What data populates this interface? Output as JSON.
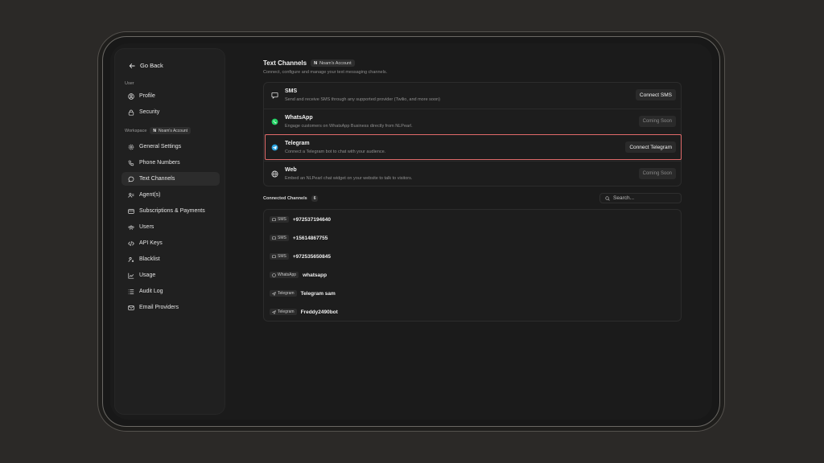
{
  "sidebar": {
    "go_back": "Go Back",
    "user_section": "User",
    "workspace_section": "Workspace",
    "workspace_badge_initial": "N",
    "workspace_badge_name": "Noam's Account",
    "items": [
      {
        "label": "Profile",
        "icon": "user-circle-icon"
      },
      {
        "label": "Security",
        "icon": "lock-icon"
      },
      {
        "label": "General Settings",
        "icon": "gear-icon"
      },
      {
        "label": "Phone Numbers",
        "icon": "phone-icon"
      },
      {
        "label": "Text Channels",
        "icon": "chat-bubble-icon",
        "active": true
      },
      {
        "label": "Agent(s)",
        "icon": "users-icon"
      },
      {
        "label": "Subscriptions & Payments",
        "icon": "credit-card-icon"
      },
      {
        "label": "Users",
        "icon": "users-group-icon"
      },
      {
        "label": "API Keys",
        "icon": "code-icon"
      },
      {
        "label": "Blacklist",
        "icon": "user-x-icon"
      },
      {
        "label": "Usage",
        "icon": "chart-icon"
      },
      {
        "label": "Audit Log",
        "icon": "list-icon"
      },
      {
        "label": "Email Providers",
        "icon": "mail-icon"
      }
    ]
  },
  "header": {
    "title": "Text Channels",
    "badge_initial": "N",
    "badge_name": "Noam's Account",
    "subtitle": "Connect, configure and manage your text messaging channels."
  },
  "channels": [
    {
      "name": "SMS",
      "desc": "Send and receive SMS through any supported provider (Twilio, and more soon)",
      "button": "Connect SMS",
      "soon": false,
      "icon": "message-square-icon"
    },
    {
      "name": "WhatsApp",
      "desc": "Engage customers on WhatsApp Business directly from NLPearl.",
      "button": "Coming Soon",
      "soon": true,
      "icon": "whatsapp-icon"
    },
    {
      "name": "Telegram",
      "desc": "Connect a Telegram bot to chat with your audience.",
      "button": "Connect Telegram",
      "soon": false,
      "icon": "telegram-icon"
    },
    {
      "name": "Web",
      "desc": "Embed an NLPearl chat widget on your website to talk to visitors.",
      "button": "Coming Soon",
      "soon": true,
      "icon": "globe-icon"
    }
  ],
  "connected": {
    "title": "Connected Channels",
    "count": "6",
    "search_placeholder": "Search...",
    "items": [
      {
        "type": "SMS",
        "name": "+972537194640"
      },
      {
        "type": "SMS",
        "name": "+15614867755"
      },
      {
        "type": "SMS",
        "name": "+972535650845"
      },
      {
        "type": "WhatsApp",
        "name": "whatsapp"
      },
      {
        "type": "Telegram",
        "name": "Telegram sam"
      },
      {
        "type": "Telegram",
        "name": "Freddy2490bot"
      }
    ]
  },
  "colors": {
    "highlight": "#e06a6a",
    "telegram": "#2aa3e0",
    "whatsapp": "#25d366"
  }
}
